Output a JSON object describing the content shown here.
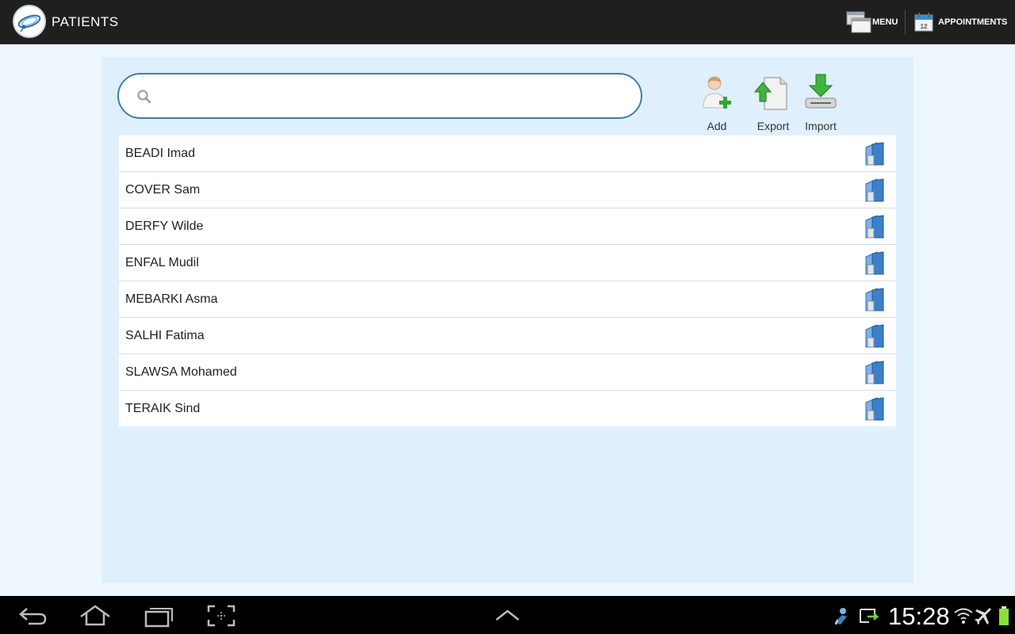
{
  "app": {
    "title": "PATIENTS",
    "menu_label": "MENU",
    "appointments_label": "APPOINTMENTS",
    "logo_icon": "stethoscope-logo-icon"
  },
  "search": {
    "value": "",
    "placeholder": "",
    "icon": "search-icon"
  },
  "tools": {
    "add_label": "Add",
    "export_label": "Export",
    "import_label": "Import"
  },
  "patients": [
    {
      "name": "BEADI Imad"
    },
    {
      "name": "COVER Sam"
    },
    {
      "name": "DERFY Wilde"
    },
    {
      "name": "ENFAL Mudil"
    },
    {
      "name": "MEBARKI Asma"
    },
    {
      "name": "SALHI Fatima"
    },
    {
      "name": "SLAWSA Mohamed"
    },
    {
      "name": "TERAIK Sind"
    }
  ],
  "system": {
    "clock": "15:28"
  },
  "colors": {
    "actionbar": "#1f1f1f",
    "panel": "#dff0fc",
    "search_border": "#3c7fa6",
    "folder_blue": "#3d7fc9"
  }
}
